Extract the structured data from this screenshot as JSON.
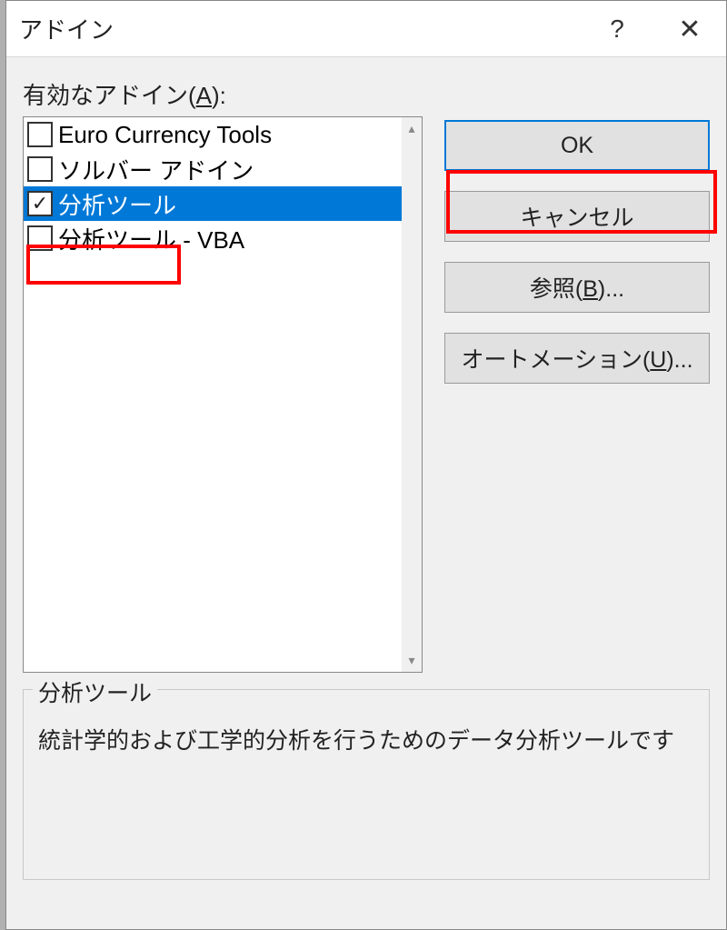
{
  "title": "アドイン",
  "list_label_prefix": "有効なアドイン(",
  "list_label_accel": "A",
  "list_label_suffix": "):",
  "addins": [
    {
      "label": "Euro Currency Tools",
      "checked": false,
      "selected": false
    },
    {
      "label": "ソルバー アドイン",
      "checked": false,
      "selected": false
    },
    {
      "label": "分析ツール",
      "checked": true,
      "selected": true
    },
    {
      "label": "分析ツール - VBA",
      "checked": false,
      "selected": false
    }
  ],
  "buttons": {
    "ok": "OK",
    "cancel": "キャンセル",
    "browse_prefix": "参照(",
    "browse_accel": "B",
    "browse_suffix": ")...",
    "automation_prefix": "オートメーション(",
    "automation_accel": "U",
    "automation_suffix": ")..."
  },
  "description": {
    "title": "分析ツール",
    "text": "統計学的および工学的分析を行うためのデータ分析ツールです"
  }
}
